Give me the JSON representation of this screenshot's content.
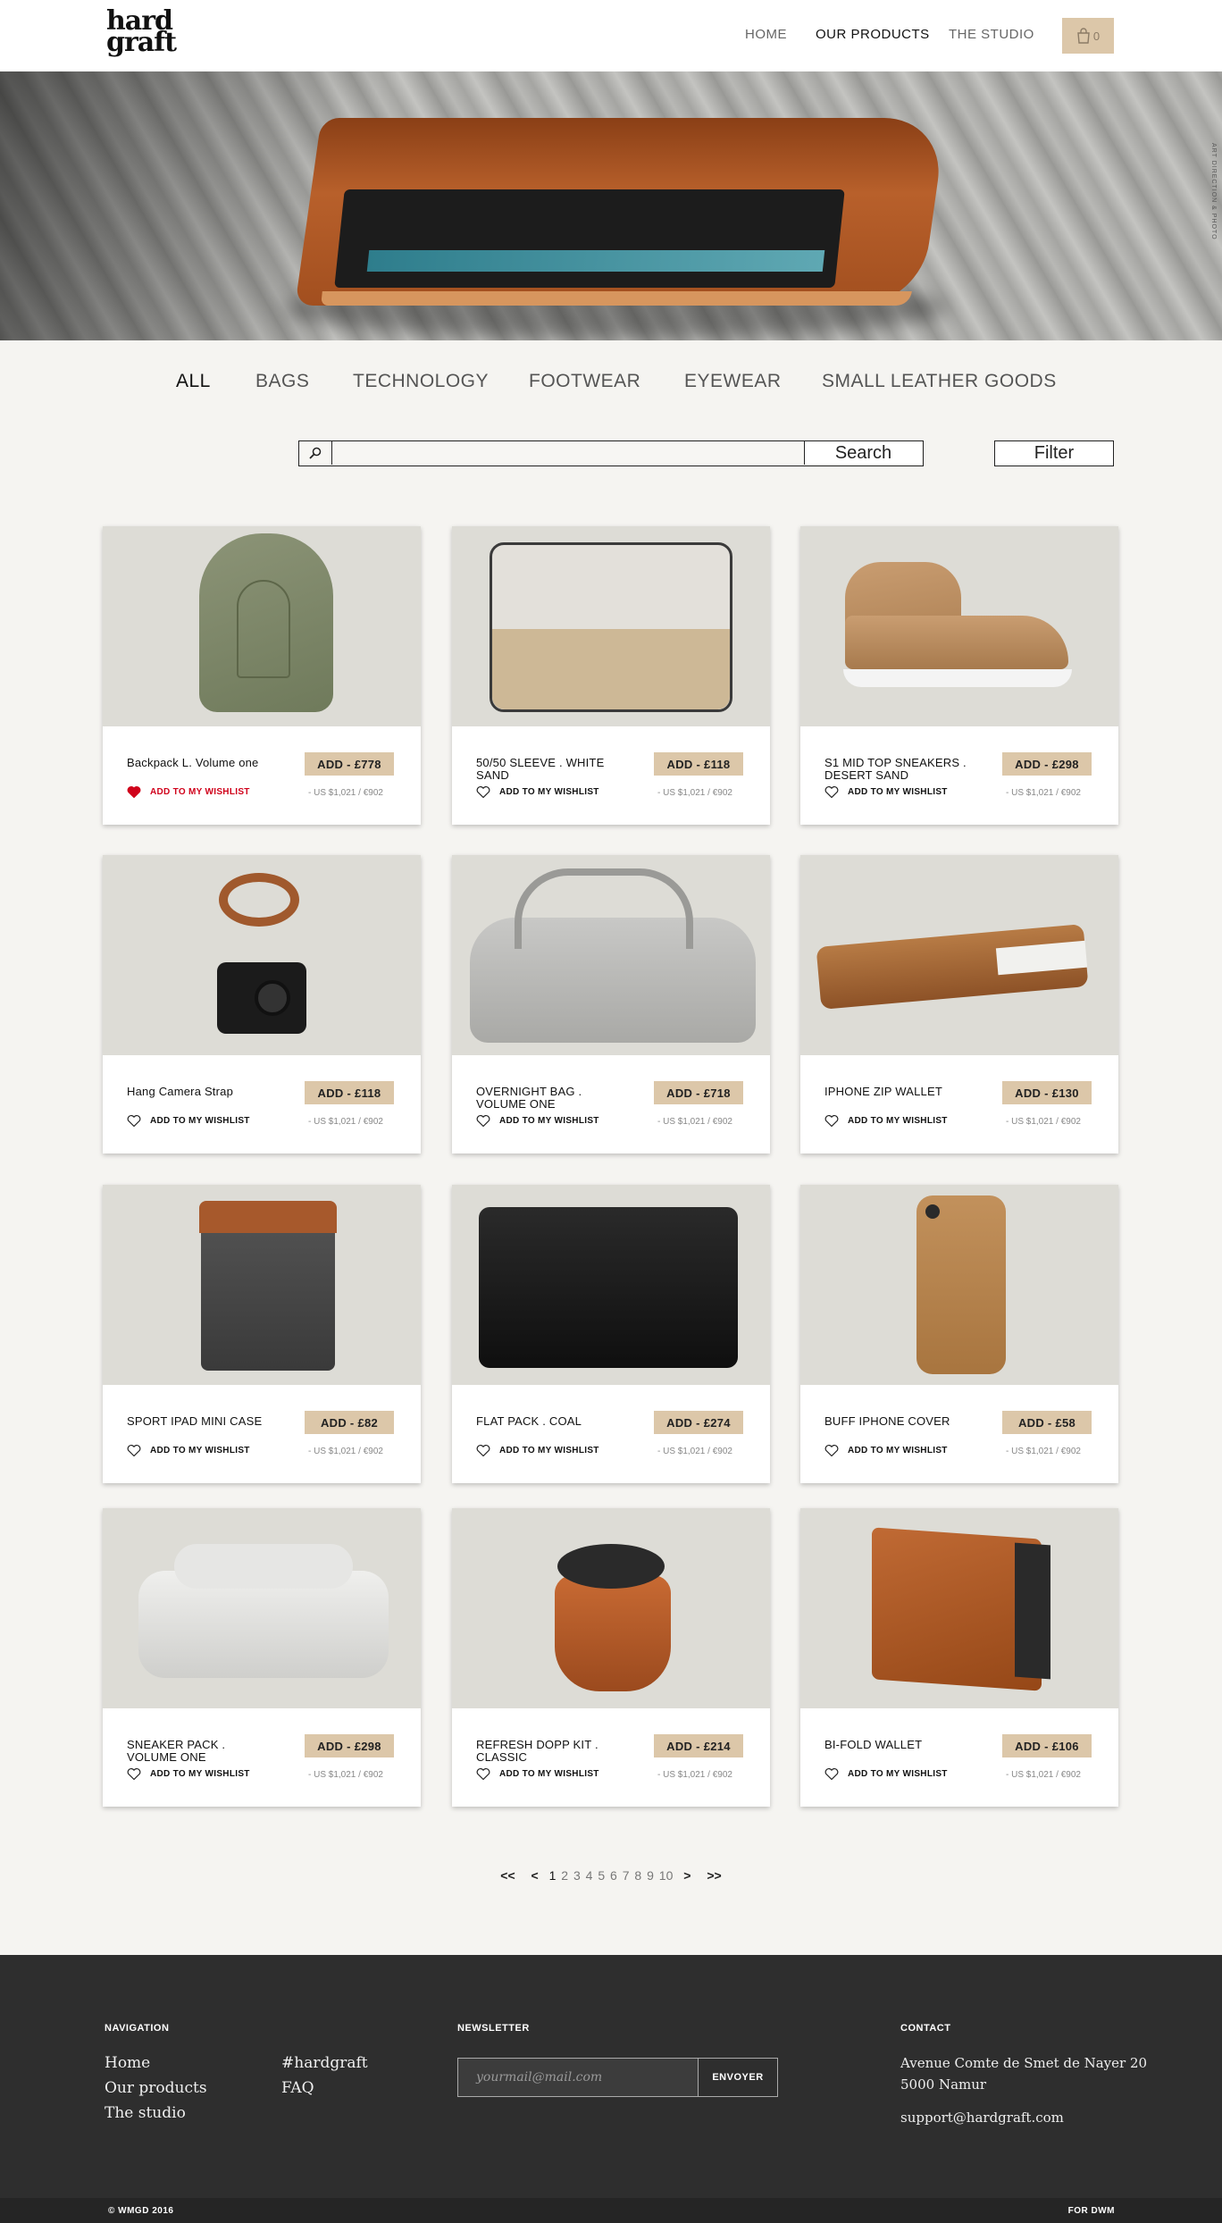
{
  "header": {
    "logo_line1": "hard",
    "logo_line2": "graft",
    "nav": [
      "HOME",
      "OUR PRODUCTS",
      "THE STUDIO"
    ],
    "active_nav": "OUR PRODUCTS",
    "cart_count": "0",
    "cart_icon": "shopping-bag-icon"
  },
  "hero": {
    "side_text": "ART DIRECTION & PHOTO"
  },
  "categories": [
    "ALL",
    "BAGS",
    "TECHNOLOGY",
    "FOOTWEAR",
    "EYEWEAR",
    "SMALL LEATHER GOODS"
  ],
  "active_category": "ALL",
  "search": {
    "value": "",
    "button": "Search",
    "filter": "Filter",
    "icon": "search-icon"
  },
  "wishlist_label": "ADD TO MY WISHLIST",
  "products": [
    {
      "name": "Backpack L. Volume one",
      "price": "ADD - £778",
      "alt_price": "- US $1,021 / €902",
      "wishlisted": true
    },
    {
      "name": "50/50 SLEEVE . WHITE SAND",
      "price": "ADD - £118",
      "alt_price": "- US $1,021 / €902",
      "wishlisted": false
    },
    {
      "name": "S1 MID TOP SNEAKERS . DESERT SAND",
      "price": "ADD - £298",
      "alt_price": "- US $1,021 / €902",
      "wishlisted": false
    },
    {
      "name": "Hang Camera Strap",
      "price": "ADD - £118",
      "alt_price": "- US $1,021 / €902",
      "wishlisted": false
    },
    {
      "name": "OVERNIGHT BAG . VOLUME ONE",
      "price": "ADD - £718",
      "alt_price": "- US $1,021 / €902",
      "wishlisted": false
    },
    {
      "name": "IPHONE ZIP WALLET",
      "price": "ADD - £130",
      "alt_price": "- US $1,021 / €902",
      "wishlisted": false
    },
    {
      "name": "SPORT IPAD MINI CASE",
      "price": "ADD - £82",
      "alt_price": "- US $1,021 / €902",
      "wishlisted": false
    },
    {
      "name": "FLAT PACK . COAL",
      "price": "ADD - £274",
      "alt_price": "- US $1,021 / €902",
      "wishlisted": false
    },
    {
      "name": "BUFF IPHONE COVER",
      "price": "ADD - £58",
      "alt_price": "- US $1,021 / €902",
      "wishlisted": false
    },
    {
      "name": "SNEAKER PACK . VOLUME ONE",
      "price": "ADD - £298",
      "alt_price": "- US $1,021 / €902",
      "wishlisted": false
    },
    {
      "name": "REFRESH DOPP KIT . CLASSIC",
      "price": "ADD - £214",
      "alt_price": "- US $1,021 / €902",
      "wishlisted": false
    },
    {
      "name": "BI-FOLD WALLET",
      "price": "ADD - £106",
      "alt_price": "- US $1,021 / €902",
      "wishlisted": false
    }
  ],
  "pagination": {
    "first": "<<",
    "prev": "<",
    "pages": [
      "1",
      "2",
      "3",
      "4",
      "5",
      "6",
      "7",
      "8",
      "9",
      "10"
    ],
    "current": "1",
    "next": ">",
    "last": ">>"
  },
  "footer": {
    "navigation_heading": "NAVIGATION",
    "nav_links": [
      "Home",
      "Our products",
      "The studio"
    ],
    "extra_links": [
      "#hardgraft",
      "FAQ"
    ],
    "newsletter_heading": "NEWSLETTER",
    "newsletter_placeholder": "yourmail@mail.com",
    "newsletter_button": "ENVOYER",
    "contact_heading": "CONTACT",
    "address_line1": "Avenue Comte de Smet de Nayer 20",
    "address_line2": "5000 Namur",
    "email": "support@hardgraft.com",
    "copyright": "© WMGD 2016",
    "credit": "FOR DWM"
  },
  "colors": {
    "accent": "#dcc7a9",
    "wishlist_active": "#d0021b",
    "footer_bg": "#2e2e2e"
  }
}
